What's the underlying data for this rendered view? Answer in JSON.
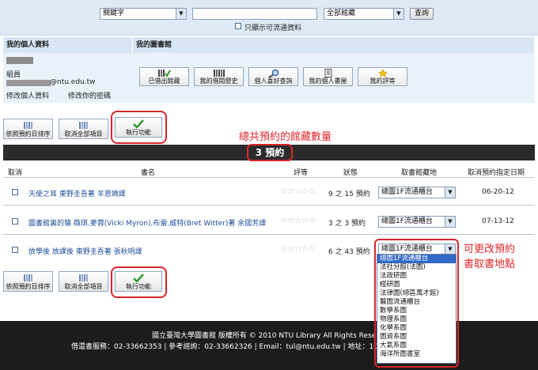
{
  "search": {
    "field_select": "關鍵字",
    "query_value": "",
    "library_select": "全部館藏",
    "search_button": "查詢",
    "available_only_label": "只顯示可流通資料"
  },
  "profile": {
    "heading": "我的個人資料",
    "role": "組員",
    "email_domain": "@ntu.edu.tw",
    "edit_profile_link": "修改個人資料",
    "edit_password_link": "修改你的密碼"
  },
  "library": {
    "heading": "我的圖書館",
    "buttons": [
      {
        "label": "已借出館藏",
        "icon": "books-check-icon"
      },
      {
        "label": "我的借閱歷史",
        "icon": "books-icon"
      },
      {
        "label": "個人喜好查詢",
        "icon": "magnifier-icon"
      },
      {
        "label": "我的個人書屋",
        "icon": "notebook-icon"
      },
      {
        "label": "我的評等",
        "icon": "star-icon"
      }
    ]
  },
  "actions": {
    "sort_label": "依照預約日排序",
    "cancel_all_label": "取消全部項目",
    "execute_label": "執行功能"
  },
  "annotations": {
    "total_note": "總共預約的館藏數量",
    "pickup_note_line1": "可更改預約",
    "pickup_note_line2": "書取書地點"
  },
  "holds_count": "3 預約",
  "table": {
    "headers": [
      "取消",
      "書名",
      "評等",
      "狀態",
      "取書館藏地",
      "取消預約指定日期"
    ],
    "rows": [
      {
        "title": "天使之耳 東野圭吾著 羊恩媺譯",
        "rating": 0,
        "status": "9 之 15 預約",
        "pickup": "總圖1F流通櫃台",
        "date": "06-20-12"
      },
      {
        "title": "圖書館裏的貓 薇琪.麥蓉(Vicki Myron),布雷.威特(Bret Witter)著 余國芳譯",
        "rating": 0,
        "status": "3 之 3 預約",
        "pickup": "總圖1F流通櫃台",
        "date": "07-13-12"
      },
      {
        "title": "放學後 放課後 東野圭吾著 張秋明譯",
        "rating": 0,
        "status": "6 之 43 預約",
        "pickup": "總圖1F流通櫃台",
        "date": ""
      }
    ]
  },
  "pickup_options": [
    "總圖1F流通櫃台",
    "法社分館(法圖)",
    "法政研圖",
    "經研圖",
    "法律圖(總區萬才館)",
    "醫圖流通櫃台",
    "數學系圖",
    "物理系圖",
    "化學系圖",
    "圖資系圖",
    "大氣系圖",
    "海洋所圖書室"
  ],
  "footer": {
    "line1": "國立臺灣大學圖書館 版權所有 © 2010 NTU Library All Rights Reserve",
    "line2": "借還書服務：02-33662353 | 參考諮詢：02-33662326 | Email：tul@ntu.edu.tw | 地址：10617臺"
  },
  "colors": {
    "accent_red": "#d8262c",
    "link_blue": "#1f4e96",
    "header_blue": "#d7e5f5",
    "dark_bar": "#2b2b2b"
  }
}
